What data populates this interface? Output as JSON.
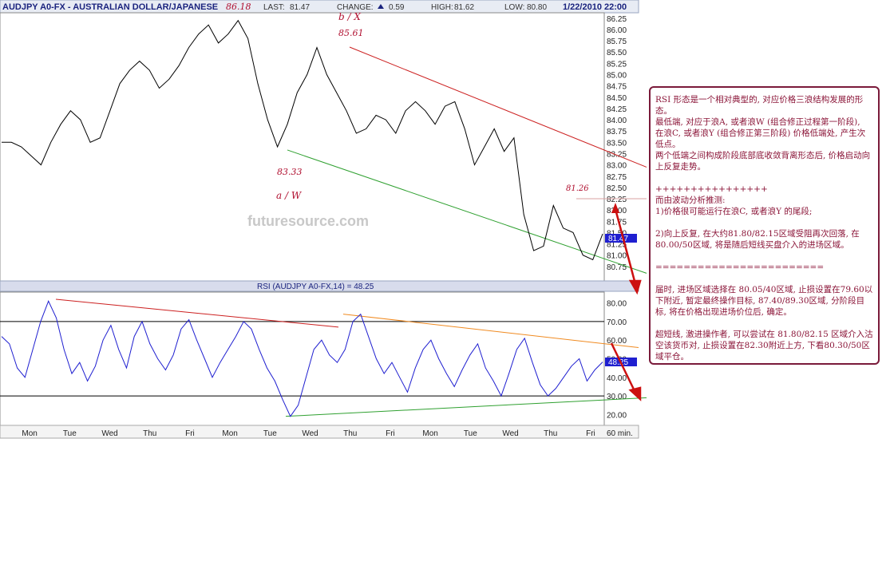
{
  "header": {
    "symbol": "AUDJPY A0-FX - AUSTRALIAN DOLLAR/JAPANESE",
    "high_marker": "86.18",
    "last_label": "LAST:",
    "last_value": "81.47",
    "change_label": "CHANGE:",
    "change_value": "0.59",
    "high_label": "HIGH:",
    "high_value": "81.62",
    "low_label": "LOW:",
    "low_value": "80.80",
    "datetime": "1/22/2010 22:00"
  },
  "colors": {
    "price_line": "#000000",
    "rsi_line": "#1f1fd0",
    "red_trend": "#cc2020",
    "green_trend": "#2fa030",
    "orange_trend": "#f08a20",
    "annotation": "#b01030",
    "note_border": "#7a1a3a",
    "last_badge": "#1f1fd0"
  },
  "annotations": {
    "bx_label": "b / X",
    "bx_value": "85.61",
    "aw_value": "83.33",
    "aw_label": "a / W",
    "low_value": "81.26",
    "watermark": "futuresource.com"
  },
  "rsi": {
    "title": "RSI (AUDJPY A0-FX,14) = 48.25",
    "last_badge": "48.25"
  },
  "chart_data": [
    {
      "type": "line",
      "title": "AUDJPY A0-FX - AUSTRALIAN DOLLAR/JAPANESE",
      "xlabel": "",
      "ylabel": "",
      "x": [
        "Mon",
        "Tue",
        "Wed",
        "Thu",
        "Fri",
        "Mon",
        "Tue",
        "Wed",
        "Thu",
        "Fri",
        "Mon",
        "Tue",
        "Wed",
        "Thu",
        "Fri"
      ],
      "x_unit_label": "60 min.",
      "ylim": [
        80.5,
        86.3
      ],
      "yticks": [
        "86.25",
        "86.00",
        "85.75",
        "85.50",
        "85.25",
        "85.00",
        "84.75",
        "84.50",
        "84.25",
        "84.00",
        "83.75",
        "83.50",
        "83.25",
        "83.00",
        "82.75",
        "82.50",
        "82.25",
        "82.00",
        "81.75",
        "81.50",
        "81.25",
        "81.00",
        "80.75"
      ],
      "last_badge": "81.47",
      "series": [
        {
          "values": [
            83.5,
            83.5,
            83.4,
            83.2,
            83.0,
            83.5,
            83.9,
            84.2,
            84.0,
            83.5,
            83.6,
            84.2,
            84.8,
            85.1,
            85.3,
            85.1,
            84.7,
            84.9,
            85.2,
            85.6,
            85.9,
            86.1,
            85.7,
            85.9,
            86.2,
            85.8,
            84.8,
            84.0,
            83.4,
            83.9,
            84.6,
            85.0,
            85.6,
            85.0,
            84.6,
            84.2,
            83.7,
            83.8,
            84.1,
            84.0,
            83.7,
            84.2,
            84.4,
            84.2,
            83.9,
            84.3,
            84.4,
            83.8,
            83.0,
            83.4,
            83.8,
            83.3,
            83.6,
            81.9,
            81.1,
            81.2,
            82.1,
            81.6,
            81.5,
            81.0,
            80.9,
            81.47
          ]
        }
      ],
      "trendlines": [
        {
          "name": "red",
          "from": 85.61,
          "to": 82.95
        },
        {
          "name": "green",
          "from": 83.33,
          "to": 80.6
        }
      ],
      "grid": false
    },
    {
      "type": "line",
      "title": "RSI (AUDJPY A0-FX,14) = 48.25",
      "ylim": [
        15,
        85
      ],
      "yticks": [
        "80.00",
        "70.00",
        "60.00",
        "50.00",
        "40.00",
        "30.00",
        "20.00"
      ],
      "reference_lines": [
        70,
        30
      ],
      "series": [
        {
          "values": [
            62,
            58,
            45,
            40,
            55,
            70,
            81,
            72,
            55,
            42,
            48,
            38,
            46,
            60,
            68,
            55,
            45,
            62,
            70,
            58,
            50,
            44,
            52,
            66,
            71,
            60,
            50,
            40,
            48,
            55,
            62,
            70,
            66,
            55,
            45,
            38,
            28,
            19,
            25,
            40,
            55,
            60,
            52,
            48,
            55,
            70,
            74,
            62,
            50,
            42,
            48,
            40,
            32,
            45,
            55,
            60,
            50,
            42,
            35,
            44,
            52,
            58,
            45,
            38,
            30,
            42,
            55,
            61,
            48,
            36,
            30,
            34,
            40,
            46,
            50,
            38,
            44,
            48.25
          ]
        }
      ],
      "trendlines": [
        {
          "name": "red",
          "from": 82,
          "to": 67
        },
        {
          "name": "orange",
          "from": 74,
          "to": 56
        },
        {
          "name": "green",
          "from": 19,
          "to": 29
        }
      ]
    }
  ],
  "note": {
    "paragraphs": [
      "RSI 形态是一个相对典型的, 对应价格三浪结构发展的形态。",
      "最低端, 对应于浪A, 或者浪W (组合修正过程第一阶段),",
      "在浪C, 或者浪Y (组合修正第三阶段) 价格低端处, 产生次低点。",
      "两个低端之间构成阶段底部底收敛背离形态后, 价格启动向上反复走势。",
      "++++++++++++++++",
      "而由波动分析推测:",
      "1)价格很可能运行在浪C, 或者浪Y 的尾段;",
      "2)向上反复, 在大约81.80/82.15区域受阻再次回落, 在80.00/50区域, 将是随后短线买盘介入的进场区域。",
      "========================",
      "届时, 进场区域选择在 80.05/40区域, 止损设置在79.60以下附近, 暂定最终操作目标, 87.40/89.30区域, 分阶段目标, 将在价格出现进场价位后, 确定。",
      "超短线, 激进操作者, 可以尝试在 81.80/82.15 区域介入沽空该货币对, 止损设置在82.30附近上方, 下看80.30/50区域平仓。"
    ]
  }
}
